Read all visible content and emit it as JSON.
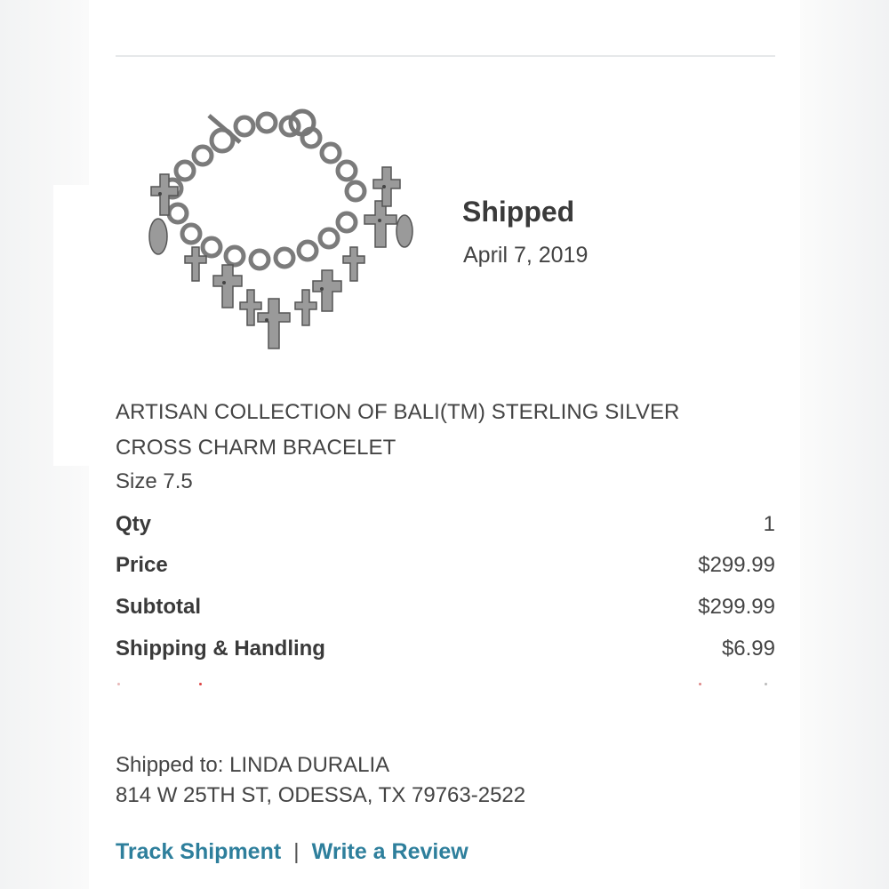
{
  "order": {
    "status": "Shipped",
    "status_date": "April 7, 2019"
  },
  "product": {
    "image_icon": "cross-charm-bracelet-image",
    "title_line1": "ARTISAN COLLECTION OF BALI(TM) STERLING SILVER",
    "title_line2": "CROSS CHARM BRACELET",
    "size": "Size 7.5"
  },
  "summary": [
    {
      "label": "Qty",
      "value": "1"
    },
    {
      "label": "Price",
      "value": "$299.99"
    },
    {
      "label": "Subtotal",
      "value": "$299.99"
    },
    {
      "label": "Shipping & Handling",
      "value": "$6.99"
    }
  ],
  "shipping": {
    "line1": "Shipped to:  LINDA   DURALIA",
    "line2": "814 W 25TH ST, ODESSA, TX  79763-2522"
  },
  "actions": {
    "track_label": "Track Shipment",
    "separator": "|",
    "review_label": "Write a Review",
    "link_color": "#2e7f9c"
  }
}
